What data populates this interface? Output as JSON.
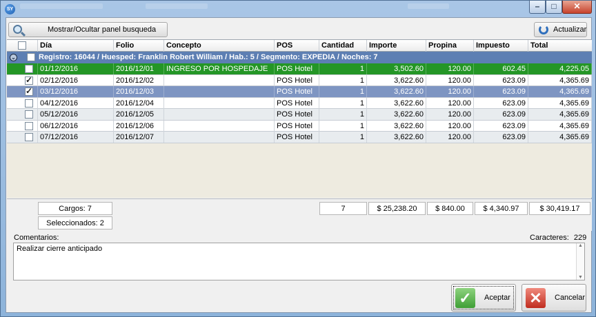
{
  "window": {
    "app_icon_text": "SY"
  },
  "toolbar": {
    "search_toggle_label": "Mostrar/Ocultar panel busqueda",
    "refresh_label": "Actualizar"
  },
  "grid": {
    "columns": [
      "Día",
      "Folio",
      "Concepto",
      "POS",
      "Cantidad",
      "Importe",
      "Propina",
      "Impuesto",
      "Total"
    ],
    "group_label": "Registro: 16044 / Huesped: Franklin Robert William / Hab.: 5 / Segmento: EXPEDIA  / Noches: 7",
    "rows": [
      {
        "checked": false,
        "dia": "01/12/2016",
        "folio": "2016/12/01",
        "concepto": "INGRESO POR HOSPEDAJE",
        "pos": "POS Hotel",
        "cantidad": "1",
        "importe": "3,502.60",
        "propina": "120.00",
        "impuesto": "602.45",
        "total": "4,225.05"
      },
      {
        "checked": true,
        "dia": "02/12/2016",
        "folio": "2016/12/02",
        "concepto": "",
        "pos": "POS Hotel",
        "cantidad": "1",
        "importe": "3,622.60",
        "propina": "120.00",
        "impuesto": "623.09",
        "total": "4,365.69"
      },
      {
        "checked": true,
        "dia": "03/12/2016",
        "folio": "2016/12/03",
        "concepto": "",
        "pos": "POS Hotel",
        "cantidad": "1",
        "importe": "3,622.60",
        "propina": "120.00",
        "impuesto": "623.09",
        "total": "4,365.69"
      },
      {
        "checked": false,
        "dia": "04/12/2016",
        "folio": "2016/12/04",
        "concepto": "",
        "pos": "POS Hotel",
        "cantidad": "1",
        "importe": "3,622.60",
        "propina": "120.00",
        "impuesto": "623.09",
        "total": "4,365.69"
      },
      {
        "checked": false,
        "dia": "05/12/2016",
        "folio": "2016/12/05",
        "concepto": "",
        "pos": "POS Hotel",
        "cantidad": "1",
        "importe": "3,622.60",
        "propina": "120.00",
        "impuesto": "623.09",
        "total": "4,365.69"
      },
      {
        "checked": false,
        "dia": "06/12/2016",
        "folio": "2016/12/06",
        "concepto": "",
        "pos": "POS Hotel",
        "cantidad": "1",
        "importe": "3,622.60",
        "propina": "120.00",
        "impuesto": "623.09",
        "total": "4,365.69"
      },
      {
        "checked": false,
        "dia": "07/12/2016",
        "folio": "2016/12/07",
        "concepto": "",
        "pos": "POS Hotel",
        "cantidad": "1",
        "importe": "3,622.60",
        "propina": "120.00",
        "impuesto": "623.09",
        "total": "4,365.69"
      }
    ]
  },
  "summary": {
    "cargos": "Cargos: 7",
    "seleccionados": "Seleccionados: 2",
    "cantidad_total": "7",
    "importe_total": "$ 25,238.20",
    "propina_total": "$ 840.00",
    "impuesto_total": "$ 4,340.97",
    "total_total": "$ 30,419.17"
  },
  "comments": {
    "label": "Comentarios:",
    "chars_label": "Caracteres:",
    "chars_count": "229",
    "text": "Realizar cierre anticipado"
  },
  "actions": {
    "accept_label": "Aceptar",
    "cancel_label": "Cancelar"
  },
  "colors": {
    "group_row": "#5d7fb3",
    "highlight_row": "#249626",
    "selected_row": "#7e95c2"
  }
}
